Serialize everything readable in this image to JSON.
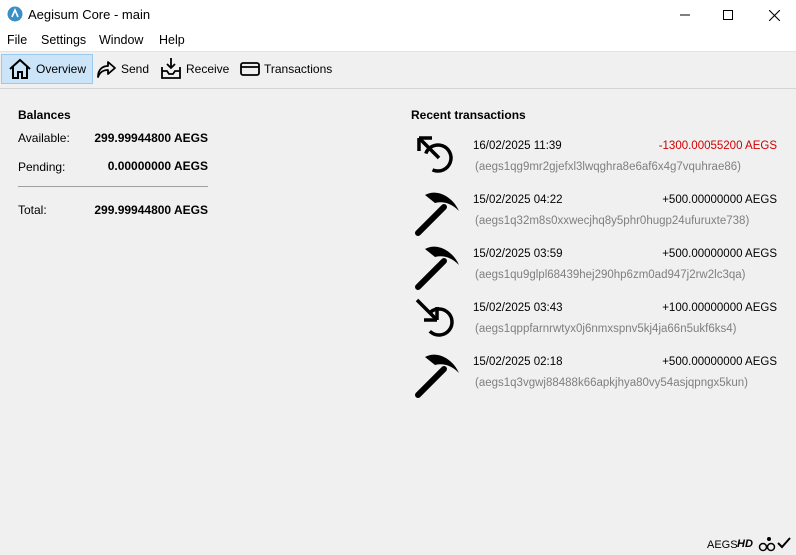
{
  "window": {
    "title": "Aegisum Core - main"
  },
  "menu": [
    "File",
    "Settings",
    "Window",
    "Help"
  ],
  "toolbar": {
    "overview": "Overview",
    "send": "Send",
    "receive": "Receive",
    "transactions": "Transactions"
  },
  "balances": {
    "title": "Balances",
    "available_label": "Available:",
    "available": "299.99944800 AEGS",
    "pending_label": "Pending:",
    "pending": "0.00000000 AEGS",
    "total_label": "Total:",
    "total": "299.99944800 AEGS"
  },
  "recent": {
    "title": "Recent transactions",
    "items": [
      {
        "icon": "sent-icon",
        "date": "16/02/2025 11:39",
        "amount": "-1300.00055200 AEGS",
        "address": "(aegs1qg9mr2gjefxl3lwqghra8e6af6x4g7vquhrae86)",
        "color": "#d00000"
      },
      {
        "icon": "mined-icon",
        "date": "15/02/2025 04:22",
        "amount": "+500.00000000 AEGS",
        "address": "(aegs1q32m8s0xxwecjhq8y5phr0hugp24ufuruxte738)",
        "color": "#000000"
      },
      {
        "icon": "mined-icon",
        "date": "15/02/2025 03:59",
        "amount": "+500.00000000 AEGS",
        "address": "(aegs1qu9glpl68439hej290hp6zm0ad947j2rw2lc3qa)",
        "color": "#000000"
      },
      {
        "icon": "received-icon",
        "date": "15/02/2025 03:43",
        "amount": "+100.00000000 AEGS",
        "address": "(aegs1qppfarnrwtyx0j6nmxspnv5kj4ja66n5ukf6ks4)",
        "color": "#000000"
      },
      {
        "icon": "mined-icon",
        "date": "15/02/2025 02:18",
        "amount": "+500.00000000 AEGS",
        "address": "(aegs1q3vgwj88488k66apkjhya80vy54asjqpngx5kun)",
        "color": "#000000"
      }
    ]
  },
  "statusbar": {
    "unit": "AEGS",
    "hd": "HD"
  }
}
